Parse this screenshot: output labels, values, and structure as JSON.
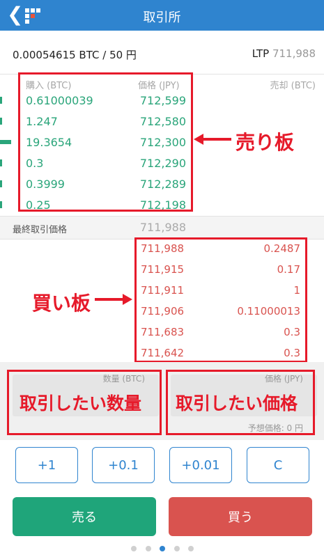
{
  "header": {
    "title": "取引所",
    "back_icon": "chevron-left-icon",
    "logo_icon": "bitflyer-logo-icon"
  },
  "summary": {
    "pair_text": "0.00054615 BTC / 50 円",
    "ltp_label": "LTP",
    "ltp_value": "711,988"
  },
  "orderbook": {
    "col_buy": "購入 (BTC)",
    "col_price": "価格 (JPY)",
    "col_sell": "売却 (BTC)",
    "sell_rows": [
      {
        "qty": "0.61000039",
        "price": "712,599"
      },
      {
        "qty": "1.247",
        "price": "712,580"
      },
      {
        "qty": "19.3654",
        "price": "712,300"
      },
      {
        "qty": "0.3",
        "price": "712,290"
      },
      {
        "qty": "0.3999",
        "price": "712,289"
      },
      {
        "qty": "0.25",
        "price": "712,198"
      }
    ],
    "last_label": "最終取引価格",
    "last_value": "711,988",
    "buy_rows": [
      {
        "price": "711,988",
        "qty": "0.2487"
      },
      {
        "price": "711,915",
        "qty": "0.17"
      },
      {
        "price": "711,911",
        "qty": "1"
      },
      {
        "price": "711,906",
        "qty": "0.11000013"
      },
      {
        "price": "711,683",
        "qty": "0.3"
      },
      {
        "price": "711,642",
        "qty": "0.3"
      }
    ]
  },
  "annotations": {
    "sell_board": "売り板",
    "buy_board": "買い板",
    "want_qty": "取引したい数量",
    "want_price": "取引したい価格"
  },
  "form": {
    "qty_label": "数量 (BTC)",
    "price_label": "価格 (JPY)",
    "estimate": "予想価格: 0 円"
  },
  "keypad": [
    "+1",
    "+0.1",
    "+0.01",
    "C"
  ],
  "actions": {
    "sell": "売る",
    "buy": "買う",
    "sell_color": "#1fa57a",
    "buy_color": "#d9534f"
  },
  "pager": {
    "count": 5,
    "active": 2
  },
  "colors": {
    "accent": "#2f84cf",
    "annotation_red": "#e61a2a",
    "sell_green": "#2aa57a"
  }
}
